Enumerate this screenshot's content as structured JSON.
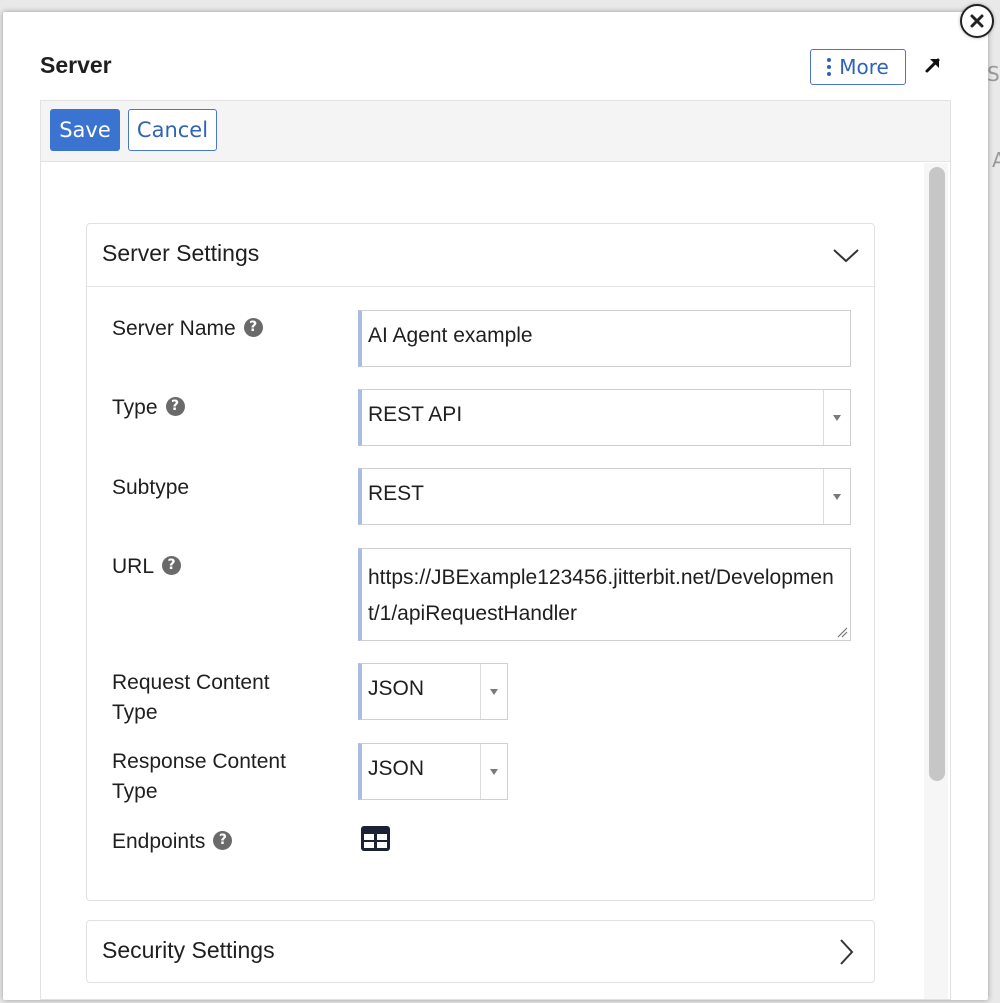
{
  "modal": {
    "title": "Server",
    "more_label": "More",
    "save_label": "Save",
    "cancel_label": "Cancel"
  },
  "background": {
    "letters": [
      "S",
      "A"
    ]
  },
  "server_settings": {
    "title": "Server Settings",
    "fields": {
      "server_name": {
        "label": "Server Name",
        "value": "AI Agent example"
      },
      "type": {
        "label": "Type",
        "value": "REST API"
      },
      "subtype": {
        "label": "Subtype",
        "value": "REST"
      },
      "url": {
        "label": "URL",
        "value": "https://JBExample123456.jitterbit.net/Development/1/apiRequestHandler"
      },
      "request_content_type": {
        "label_line1": "Request Content",
        "label_line2": "Type",
        "value": "JSON"
      },
      "response_content_type": {
        "label_line1": "Response Content",
        "label_line2": "Type",
        "value": "JSON"
      },
      "endpoints": {
        "label": "Endpoints"
      }
    }
  },
  "security_settings": {
    "title": "Security Settings"
  },
  "colors": {
    "accent": "#3b74d0",
    "field_accent": "#a9bde3"
  },
  "icons": [
    "close-icon",
    "more-dots-icon",
    "expand-arrow-icon",
    "help-icon",
    "chevron-down-icon",
    "chevron-right-icon",
    "table-icon",
    "dropdown-arrow-icon",
    "resize-grip-icon"
  ]
}
